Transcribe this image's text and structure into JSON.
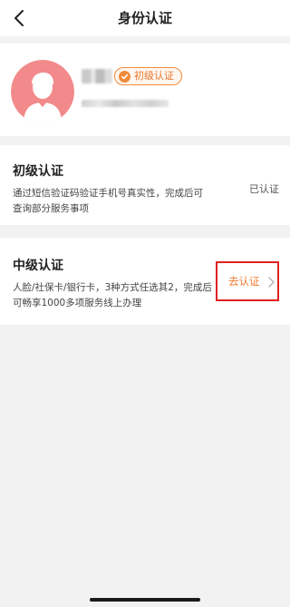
{
  "header": {
    "title": "身份认证"
  },
  "profile": {
    "badge_label": "初级认证"
  },
  "cards": [
    {
      "title": "初级认证",
      "description": "通过短信验证码验证手机号真实性，完成后可查询部分服务事项",
      "status": "已认证"
    },
    {
      "title": "中级认证",
      "description": "人脸/社保卡/银行卡，3种方式任选其2，完成后可畅享1000多项服务线上办理",
      "action_label": "去认证"
    }
  ],
  "colors": {
    "accent": "#ef7a2e",
    "highlight_border": "#e02020",
    "avatar_bg": "#f2898a"
  }
}
